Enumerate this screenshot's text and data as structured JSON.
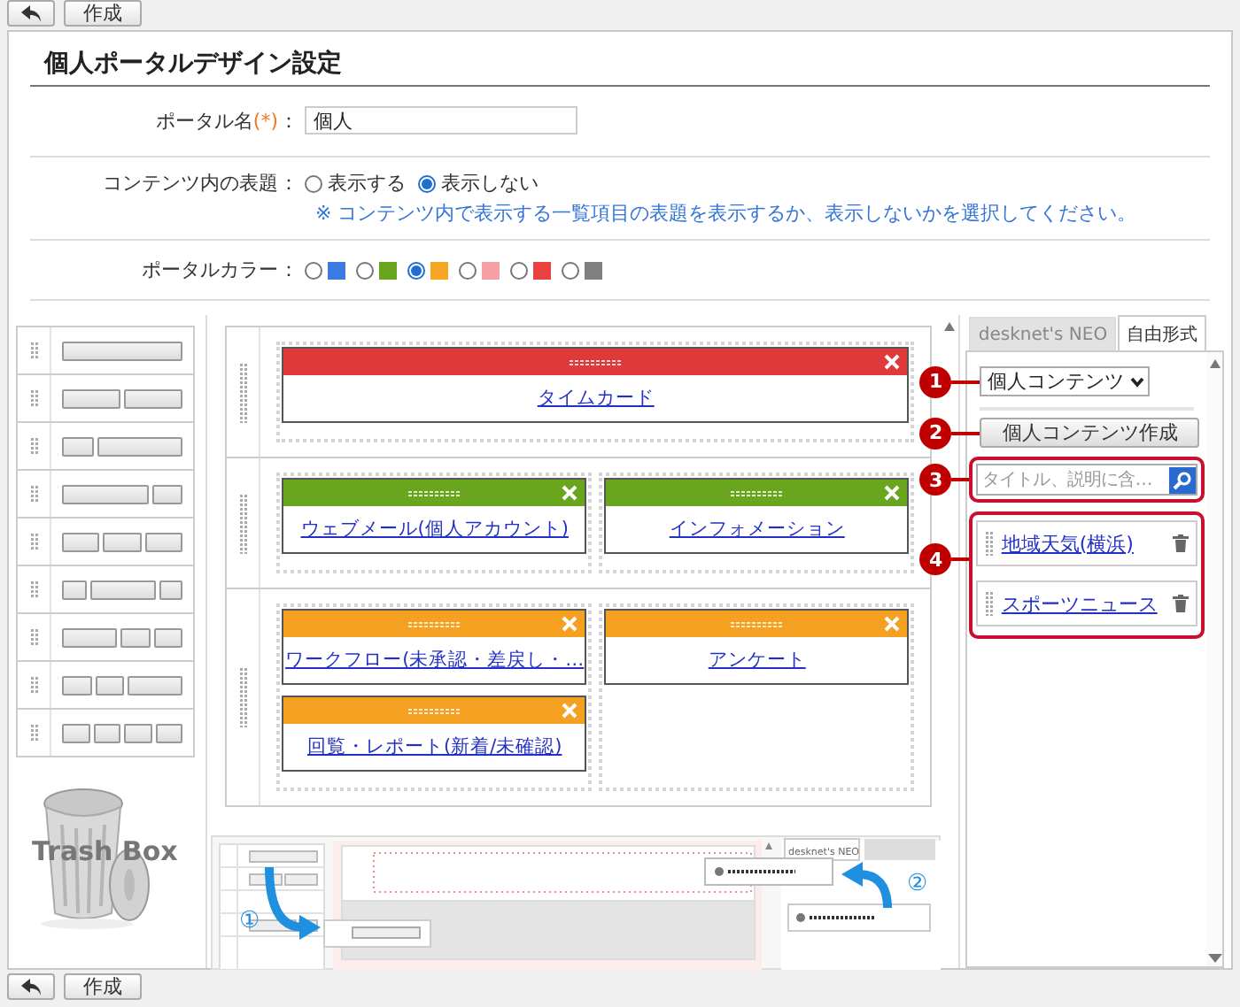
{
  "toolbar_top": {
    "buttons": [
      {
        "kind": "back"
      },
      {
        "kind": "text",
        "label": "作成"
      }
    ]
  },
  "page_title": "個人ポータルデザイン設定",
  "form": {
    "rows": [
      {
        "kind": "text",
        "label": "ポータル名",
        "required_mark": "(*)",
        "colon": "：",
        "value": "個人"
      },
      {
        "kind": "radio",
        "label": "コンテンツ内の表題",
        "colon": "：",
        "options": [
          {
            "label": "表示する",
            "selected": false
          },
          {
            "label": "表示しない",
            "selected": true
          }
        ],
        "note": "※ コンテンツ内で表示する一覧項目の表題を表示するか、表示しないかを選択してください。"
      },
      {
        "kind": "color",
        "label": "ポータルカラー",
        "colon": "：",
        "options": [
          {
            "color": "#3b7ae0",
            "selected": false
          },
          {
            "color": "#6aa51e",
            "selected": false
          },
          {
            "color": "#f5a623",
            "selected": true
          },
          {
            "color": "#f4a0a4",
            "selected": false
          },
          {
            "color": "#e8413f",
            "selected": false
          },
          {
            "color": "#808080",
            "selected": false
          }
        ]
      }
    ]
  },
  "layout_templates": [
    {
      "kind": "full"
    },
    {
      "kind": "halves"
    },
    {
      "kind": "narrow-wide"
    },
    {
      "kind": "wide-narrow"
    },
    {
      "kind": "thirds"
    },
    {
      "kind": "narrow-wide-narrow"
    },
    {
      "kind": "wide-narrow-narrow"
    },
    {
      "kind": "narrow-narrow-wide"
    },
    {
      "kind": "quarters"
    }
  ],
  "trash_box": {
    "label": "Trash Box"
  },
  "portal": {
    "rows": [
      {
        "columns": [
          [
            {
              "title": "タイムカード",
              "color": "#e0393a"
            }
          ]
        ]
      },
      {
        "columns": [
          [
            {
              "title": "ウェブメール(個人アカウント)",
              "color": "#6aa51e"
            }
          ],
          [
            {
              "title": "インフォメーション",
              "color": "#6aa51e"
            }
          ]
        ]
      },
      {
        "columns": [
          [
            {
              "title": "ワークフロー(未承認・差戻し・…",
              "color": "#f5a020"
            },
            {
              "title": "回覧・レポート(新着/未確認)",
              "color": "#f5a020"
            }
          ],
          [
            {
              "title": "アンケート",
              "color": "#f5a020"
            }
          ]
        ]
      }
    ]
  },
  "tutorial": {
    "tab_label": "desknet's NEO",
    "steps": [
      "①",
      "②"
    ]
  },
  "side_panel": {
    "tabs": [
      {
        "label": "desknet's NEO",
        "selected": false
      },
      {
        "label": "自由形式",
        "selected": true
      }
    ],
    "dropdown": "個人コンテンツ",
    "create_button": "個人コンテンツ作成",
    "search": {
      "placeholder": "タイトル、説明に含…"
    },
    "items": [
      {
        "title": "地域天気(横浜)"
      },
      {
        "title": "スポーツニュース"
      }
    ]
  },
  "callouts": [
    "1",
    "2",
    "3",
    "4"
  ],
  "toolbar_bottom": {
    "buttons": [
      {
        "kind": "back"
      },
      {
        "kind": "text",
        "label": "作成"
      }
    ]
  }
}
